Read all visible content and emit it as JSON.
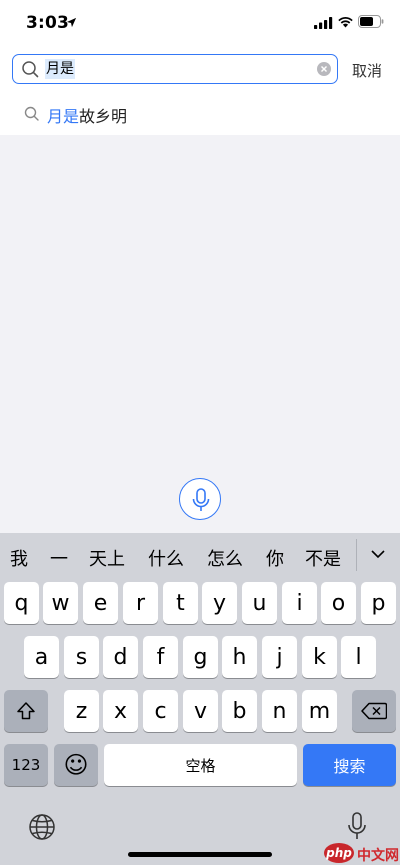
{
  "status_bar": {
    "time": "3:03"
  },
  "search": {
    "query": "月是",
    "cancel_label": "取消"
  },
  "suggestion": {
    "highlight": "月是",
    "rest": "故乡明"
  },
  "keyboard": {
    "candidates": [
      "我",
      "一",
      "天上",
      "什么",
      "怎么",
      "你",
      "不是"
    ],
    "row1": [
      "q",
      "w",
      "e",
      "r",
      "t",
      "y",
      "u",
      "i",
      "o",
      "p"
    ],
    "row2": [
      "a",
      "s",
      "d",
      "f",
      "g",
      "h",
      "j",
      "k",
      "l"
    ],
    "row3": [
      "z",
      "x",
      "c",
      "v",
      "b",
      "n",
      "m"
    ],
    "numbers_label": "123",
    "emoji_label": "☺",
    "space_label": "空格",
    "search_label": "搜索"
  },
  "watermark": {
    "logo": "php",
    "text": "中文网"
  },
  "colors": {
    "accent": "#3478f6",
    "keyboard_bg": "#d1d3d9",
    "content_bg": "#f2f2f6"
  }
}
